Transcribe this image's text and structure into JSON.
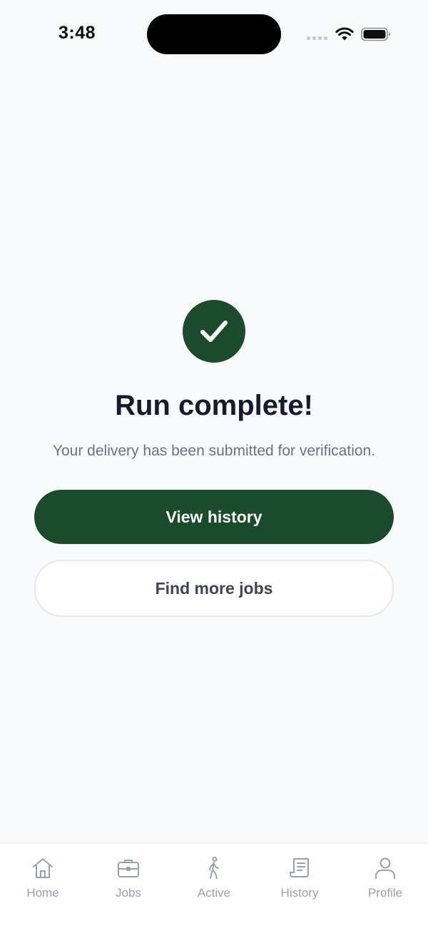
{
  "status_bar": {
    "time": "3:48"
  },
  "success": {
    "icon": "check-icon",
    "title": "Run complete!",
    "message": "Your delivery has been submitted for verification.",
    "primary_button": "View history",
    "secondary_button": "Find more jobs"
  },
  "tab_bar": {
    "items": [
      {
        "label": "Home",
        "icon": "home-icon"
      },
      {
        "label": "Jobs",
        "icon": "briefcase-icon"
      },
      {
        "label": "Active",
        "icon": "walking-icon"
      },
      {
        "label": "History",
        "icon": "receipt-icon"
      },
      {
        "label": "Profile",
        "icon": "user-icon"
      }
    ]
  },
  "colors": {
    "brand": "#1c4a2c",
    "background": "#f8fafc",
    "title": "#161b2e",
    "muted": "#6b7280",
    "tab_inactive": "#9aa0a8"
  }
}
